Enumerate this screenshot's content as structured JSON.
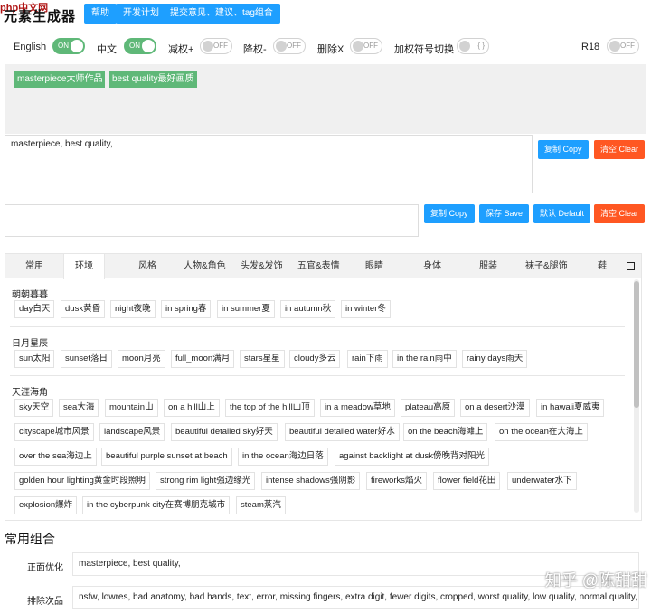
{
  "header": {
    "logo_site": "php中文网",
    "logo_title": "元素生成器",
    "buttons": [
      "帮助",
      "开发计划",
      "提交意见、建议、tag组合"
    ]
  },
  "toggles": [
    {
      "label": "English",
      "state": "ON"
    },
    {
      "label": "中文",
      "state": "ON"
    },
    {
      "label": "减权+",
      "state": "OFF"
    },
    {
      "label": "降权-",
      "state": "OFF"
    },
    {
      "label": "删除X",
      "state": "OFF"
    },
    {
      "label": "加权符号切换",
      "state": "{ }"
    },
    {
      "label": "R18",
      "state": "OFF"
    }
  ],
  "selected_tags": [
    "masterpiece大师作品",
    "best quality最好画质"
  ],
  "prompt_box": {
    "value": "masterpiece, best quality,"
  },
  "prompt_buttons": {
    "copy": "复制 Copy",
    "clear": "清空 Clear"
  },
  "second_box": {
    "value": ""
  },
  "second_buttons": {
    "copy": "复制 Copy",
    "save": "保存 Save",
    "default": "默认 Default",
    "clear": "清空 Clear"
  },
  "tabs": [
    "常用",
    "环境",
    "风格",
    "人物&角色",
    "头发&发饰",
    "五官&表情",
    "眼睛",
    "身体",
    "服装",
    "袜子&腿饰",
    "鞋"
  ],
  "active_tab": "环境",
  "sections": [
    {
      "title": "朝朝暮暮",
      "chips": [
        "day白天",
        "dusk黄昏",
        "night夜晚",
        "in spring春",
        "in summer夏",
        "in autumn秋",
        "in winter冬"
      ]
    },
    {
      "title": "日月星辰",
      "chips": [
        "sun太阳",
        "sunset落日",
        "moon月亮",
        "full_moon满月",
        "stars星星",
        "cloudy多云",
        "rain下雨",
        "in the rain雨中",
        "rainy days雨天"
      ]
    },
    {
      "title": "天涯海角",
      "chips": [
        "sky天空",
        "sea大海",
        "mountain山",
        "on a hill山上",
        "the top of the hill山顶",
        "in a meadow草地",
        "plateau高原",
        "on a desert沙漠",
        "in hawaii夏威夷",
        "cityscape城市风景",
        "landscape风景",
        "beautiful detailed sky好天",
        "beautiful detailed water好水",
        "on the beach海滩上",
        "on the ocean在大海上",
        "over the sea海边上",
        "beautiful purple sunset at beach",
        "in the ocean海边日落",
        "against backlight at dusk傍晚背对阳光",
        "golden hour lighting黄金时段照明",
        "strong rim light强边缘光",
        "intense shadows强阴影",
        "fireworks焰火",
        "flower field花田",
        "underwater水下",
        "explosion爆炸",
        "in the cyberpunk city在赛博朋克城市",
        "steam蒸汽"
      ]
    }
  ],
  "combos": {
    "title": "常用组合",
    "rows": [
      {
        "label": "正面优化",
        "value": "masterpiece, best quality,"
      },
      {
        "label": "排除次品",
        "value": "nsfw, lowres, bad anatomy, bad hands, text, error, missing fingers, extra digit, fewer digits, cropped, worst quality, low quality, normal quality, jpeg artifacts"
      }
    ]
  },
  "watermark": "知乎 @陈甜甜"
}
